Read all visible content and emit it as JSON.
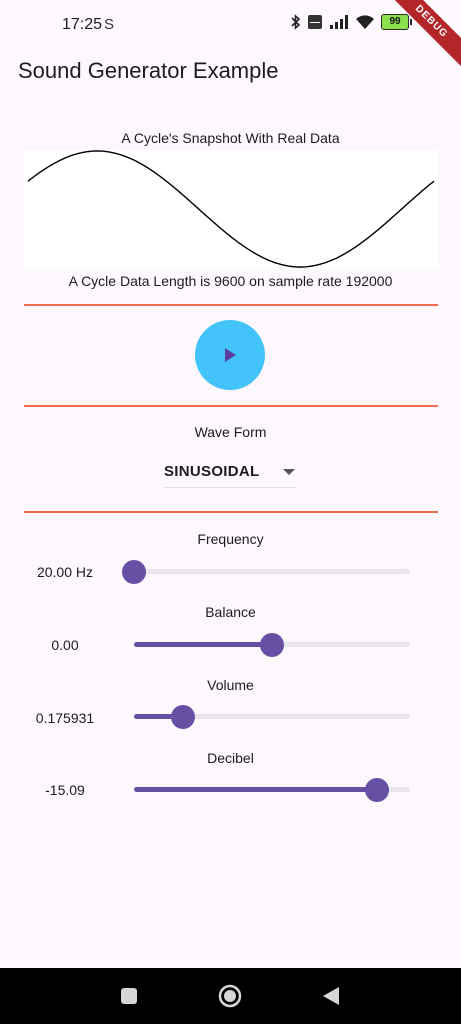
{
  "status_bar": {
    "time": "17:25",
    "s_icon": "S",
    "battery": "99",
    "debug": "DEBUG"
  },
  "app_bar": {
    "title": "Sound Generator Example"
  },
  "snapshot": {
    "title": "A Cycle's Snapshot With Real Data",
    "info": "A Cycle Data Length is 9600 on sample rate 192000"
  },
  "wave_form": {
    "label": "Wave Form",
    "selected": "SINUSOIDAL"
  },
  "sliders": {
    "frequency": {
      "label": "Frequency",
      "value_text": "20.00 Hz",
      "fraction": 0.0
    },
    "balance": {
      "label": "Balance",
      "value_text": "0.00",
      "fraction": 0.5
    },
    "volume": {
      "label": "Volume",
      "value_text": "0.175931",
      "fraction": 0.176
    },
    "decibel": {
      "label": "Decibel",
      "value_text": "-15.09",
      "fraction": 0.88
    }
  },
  "colors": {
    "accent": "#6750a4",
    "play": "#42c4fb",
    "divider": "#f06a4f"
  },
  "icons": [
    "bluetooth-icon",
    "volte-icon",
    "signal-icon",
    "wifi-icon",
    "battery-icon",
    "play-icon",
    "dropdown-arrow-icon",
    "recents-icon",
    "home-icon",
    "back-icon"
  ]
}
